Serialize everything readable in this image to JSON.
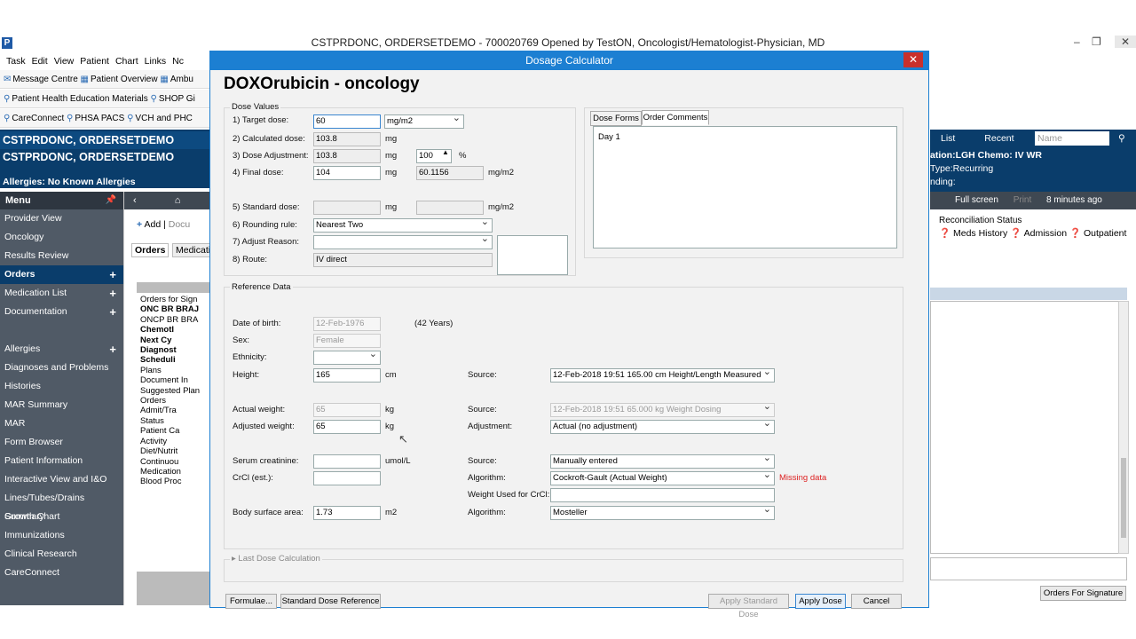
{
  "window": {
    "title": "CSTPRDONC, ORDERSETDEMO - 700020769 Opened by TestON, Oncologist/Hematologist-Physician, MD",
    "logo": "P"
  },
  "menubar": [
    "Task",
    "Edit",
    "View",
    "Patient",
    "Chart",
    "Links",
    "Nc"
  ],
  "toolbar1": [
    "Message Centre",
    "Patient Overview",
    "Ambu"
  ],
  "toolbar2": [
    "Patient Health Education Materials",
    "SHOP Gi"
  ],
  "toolbar3": [
    "CareConnect",
    "PHSA PACS",
    "VCH and PHC"
  ],
  "banner": {
    "tab": "CSTPRDONC, ORDERSETDEMO",
    "name": "CSTPRDONC, ORDERSETDEMO",
    "allergies": "Allergies: No Known Allergies"
  },
  "sidebar": {
    "menu": "Menu",
    "items": [
      "Provider View",
      "Oncology",
      "Results Review",
      "Orders",
      "Medication List",
      "Documentation",
      "",
      "Allergies",
      "Diagnoses and Problems",
      "Histories",
      "MAR Summary",
      "MAR",
      "Form Browser",
      "Patient Information",
      "Interactive View and I&O",
      "Lines/Tubes/Drains Summary",
      "Growth Chart",
      "Immunizations",
      "Clinical Research",
      "CareConnect"
    ]
  },
  "mid": {
    "add": "Add",
    "doc": "Docu",
    "tab_orders": "Orders",
    "tab_med": "Medicati",
    "tree": [
      "Orders for Sign",
      "ONC BR BRAJ",
      "ONCP BR BRA",
      "Chemotl",
      "Next Cy",
      "Diagnost",
      "Scheduli",
      "Plans",
      "Document In",
      "Suggested Plan",
      "Orders",
      "Admit/Tra",
      "Status",
      "Patient Ca",
      "Activity",
      "Diet/Nutrit",
      "Continuou",
      "Medication",
      "Blood Proc"
    ]
  },
  "right": {
    "list": "List",
    "recent": "Recent",
    "name_ph": "Name",
    "info1": "ation:LGH Chemo: IV WR",
    "info2": "Type:Recurring",
    "info3": "nding:",
    "fullscreen": "Full screen",
    "print": "Print",
    "ago": "8 minutes ago",
    "recon": "Reconciliation Status",
    "meds": "Meds History",
    "admission": "Admission",
    "outpatient": "Outpatient",
    "ofs": "Orders For Signature"
  },
  "dialog": {
    "title": "Dosage Calculator",
    "heading": "DOXOrubicin - oncology",
    "dose_values": "Dose Values",
    "labels": {
      "target": "1) Target dose:",
      "calc": "2) Calculated dose:",
      "adj": "3) Dose Adjustment:",
      "final": "4) Final dose:",
      "std": "5) Standard dose:",
      "round": "6) Rounding rule:",
      "reason": "7) Adjust Reason:",
      "route": "8) Route:"
    },
    "values": {
      "target": "60",
      "target_unit": "mg/m2",
      "calc": "103.8",
      "calc_unit": "mg",
      "adj": "103.8",
      "adj_unit": "mg",
      "adj_pct": "100",
      "pct": "%",
      "final": "104",
      "final_unit": "mg",
      "final2": "60.1156",
      "final2_unit": "mg/m2",
      "std_unit": "mg",
      "std2_unit": "mg/m2",
      "round": "Nearest Two",
      "route": "IV direct"
    },
    "tabs": {
      "t1": "Dose Forms",
      "t2": "Order Comments"
    },
    "comment": "Day 1",
    "ref": {
      "title": "Reference Data",
      "dob_l": "Date of birth:",
      "dob": "12-Feb-1976",
      "age": "(42 Years)",
      "sex_l": "Sex:",
      "sex": "Female",
      "eth_l": "Ethnicity:",
      "height_l": "Height:",
      "height": "165",
      "cm": "cm",
      "src": "Source:",
      "height_src": "12-Feb-2018 19:51   165.00 cm Height/Length Measured",
      "aw_l": "Actual weight:",
      "aw": "65",
      "kg": "kg",
      "aw_src": "12-Feb-2018 19:51   65.000 kg Weight Dosing",
      "adw_l": "Adjusted weight:",
      "adw": "65",
      "adj_l": "Adjustment:",
      "adj": "Actual (no adjustment)",
      "sc_l": "Serum creatinine:",
      "umol": "umol/L",
      "sc_src": "Manually entered",
      "crcl_l": "CrCl (est.):",
      "alg_l": "Algorithm:",
      "crcl_alg": "Cockroft-Gault (Actual Weight)",
      "missing": "Missing data",
      "wu_l": "Weight Used for CrCl:",
      "bsa_l": "Body surface area:",
      "bsa": "1.73",
      "m2": "m2",
      "bsa_alg": "Mosteller"
    },
    "last": "Last Dose Calculation",
    "buttons": {
      "formulae": "Formulae...",
      "stdref": "Standard Dose Reference",
      "applystd": "Apply Standard Dose",
      "apply": "Apply Dose",
      "cancel": "Cancel"
    }
  }
}
